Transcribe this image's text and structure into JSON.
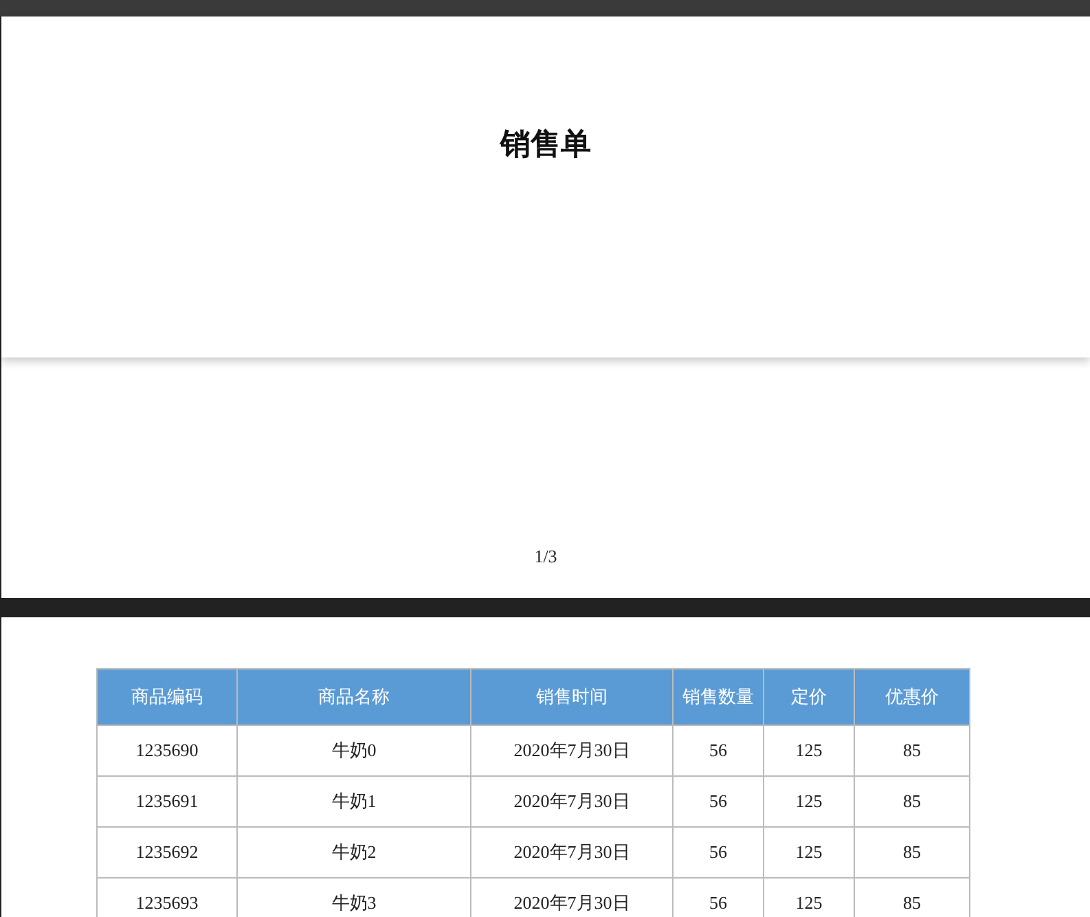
{
  "header": {
    "title": "销售单"
  },
  "page_number": "1/3",
  "table": {
    "columns": [
      "商品编码",
      "商品名称",
      "销售时间",
      "销售数量",
      "定价",
      "优惠价"
    ],
    "rows": [
      [
        "1235690",
        "牛奶0",
        "2020年7月30日",
        "56",
        "125",
        "85"
      ],
      [
        "1235691",
        "牛奶1",
        "2020年7月30日",
        "56",
        "125",
        "85"
      ],
      [
        "1235692",
        "牛奶2",
        "2020年7月30日",
        "56",
        "125",
        "85"
      ],
      [
        "1235693",
        "牛奶3",
        "2020年7月30日",
        "56",
        "125",
        "85"
      ]
    ]
  }
}
